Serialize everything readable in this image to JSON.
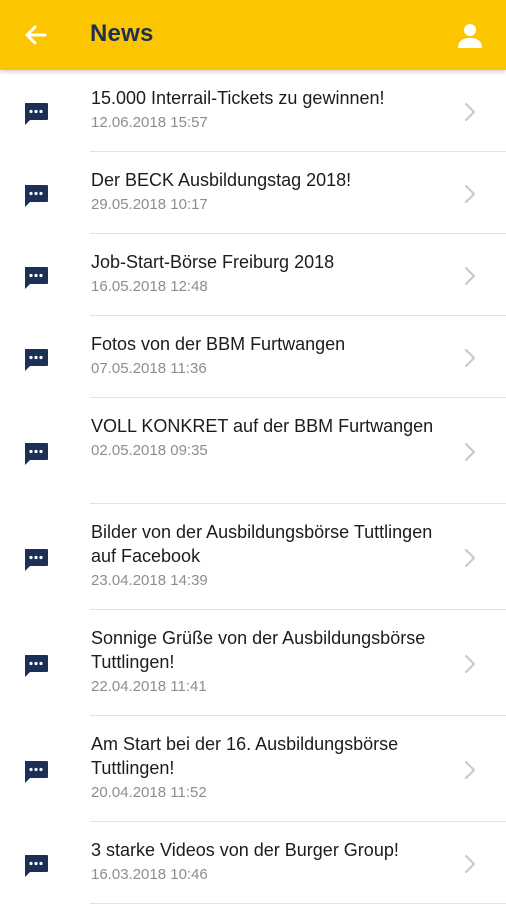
{
  "header": {
    "title": "News",
    "back_icon": "arrow-left-icon",
    "profile_icon": "user-icon",
    "background": "#fbc600",
    "title_color": "#1b2f57"
  },
  "news": [
    {
      "title": "15.000 Interrail-Tickets zu gewinnen!",
      "date": "12.06.2018 15:57"
    },
    {
      "title": "Der BECK Ausbildungstag 2018!",
      "date": "29.05.2018 10:17"
    },
    {
      "title": "Job-Start-Börse Freiburg 2018",
      "date": "16.05.2018 12:48"
    },
    {
      "title": "Fotos von der BBM Furtwangen",
      "date": "07.05.2018 11:36"
    },
    {
      "title": "VOLL KONKRET auf der BBM Furtwangen",
      "date": "02.05.2018 09:35"
    },
    {
      "title": "Bilder von der Ausbildungsbörse Tuttlingen auf Facebook",
      "date": "23.04.2018 14:39"
    },
    {
      "title": "Sonnige Grüße von der Ausbildungsbörse Tuttlingen!",
      "date": "22.04.2018 11:41"
    },
    {
      "title": "Am Start bei der 16. Ausbildungsbörse Tuttlingen!",
      "date": "20.04.2018 11:52"
    },
    {
      "title": "3 starke Videos von der Burger Group!",
      "date": "16.03.2018 10:46"
    }
  ],
  "list_icons": {
    "item_icon": "chat-bubble-icon",
    "chevron_icon": "chevron-right-icon",
    "icon_color": "#1b2f57"
  }
}
